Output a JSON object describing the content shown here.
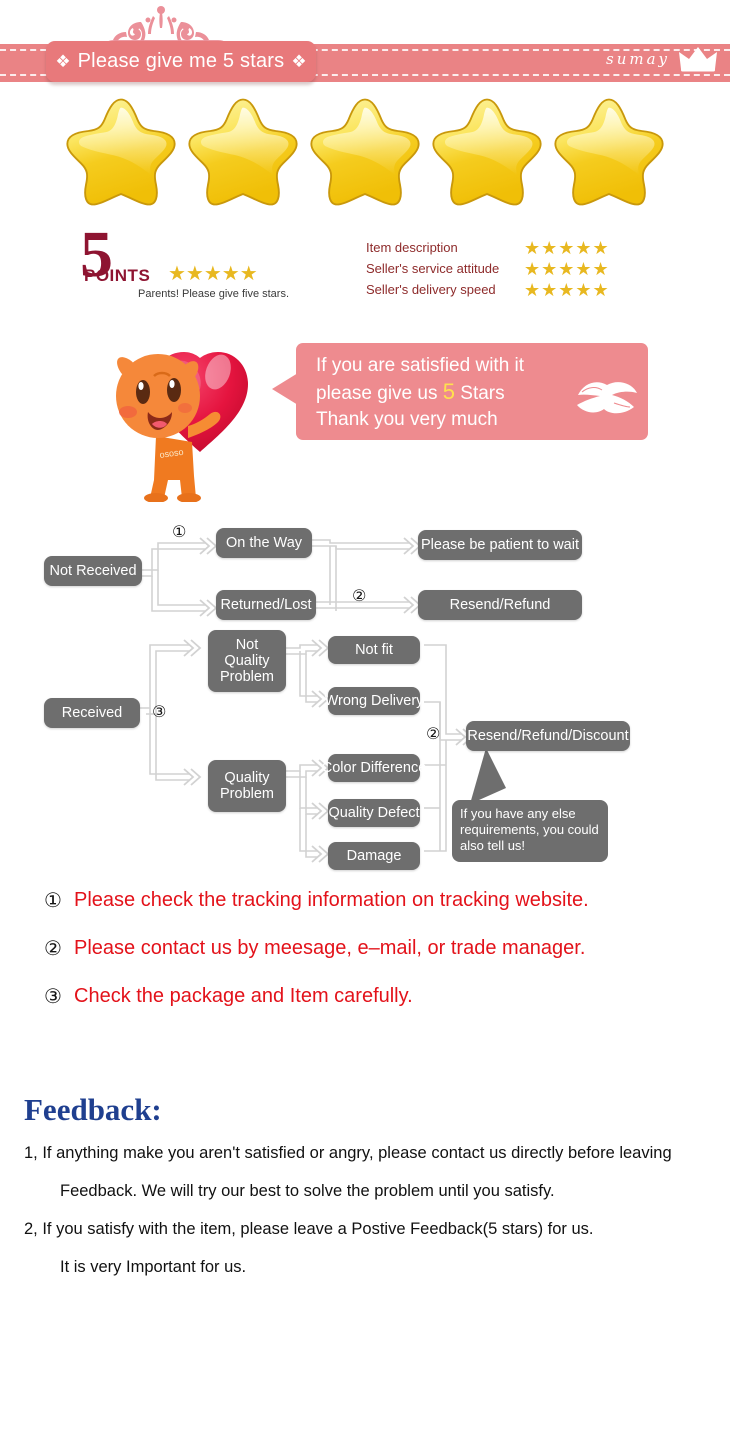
{
  "header": {
    "title": "Please give me 5 stars",
    "brand": "sumay",
    "crown_icon": "crown-icon",
    "left_bowtie_icon": "ribbon-bow-icon",
    "right_bowtie_icon": "ribbon-bow-icon",
    "banner_color": "#ea8385",
    "plaque_color": "#e8797b"
  },
  "big_stars": {
    "count": 5,
    "icon": "gold-star-icon",
    "color": "#f5cc1e"
  },
  "points": {
    "number": "5",
    "word": "POINTS",
    "stars": "★★★★★",
    "caption": "Parents! Please give five stars.",
    "color": "#8e1431"
  },
  "ratings": {
    "rows": [
      {
        "label": "Item description",
        "stars": "★★★★★",
        "value": 5
      },
      {
        "label": "Seller's service attitude",
        "stars": "★★★★★",
        "value": 5
      },
      {
        "label": "Seller's delivery speed",
        "stars": "★★★★★",
        "value": 5
      }
    ],
    "star_color": "#e8b820",
    "label_color": "#8e2b2b"
  },
  "mascot": {
    "icon": "orange-mascot-holding-heart-icon",
    "heart_icon": "red-heart-icon"
  },
  "bubble": {
    "line1": "If you are satisfied with it",
    "line2_a": "please give us",
    "line2_highlight": "5",
    "line2_b": "Stars",
    "line3": "Thank you very much",
    "lips_icon": "lips-kiss-icon",
    "color": "#ee8b8f",
    "highlight_color": "#ffe14d"
  },
  "flow": {
    "box_color": "#6e6e6e",
    "not_received": "Not Received",
    "on_the_way": "On the Way",
    "returned_lost": "Returned/Lost",
    "please_wait": "Please be patient to wait",
    "resend_refund": "Resend/Refund",
    "received": "Received",
    "not_quality_problem": "Not\nQuality\nProblem",
    "not_quality_problem_l1": "Not",
    "not_quality_problem_l2": "Quality",
    "not_quality_problem_l3": "Problem",
    "not_fit": "Not fit",
    "wrong_delivery": "Wrong Delivery",
    "quality_problem_l1": "Quality",
    "quality_problem_l2": "Problem",
    "color_difference": "Color Difference",
    "quality_defect": "Quality Defect",
    "damage": "Damage",
    "resend_refund_discount": "Resend/Refund/Discount",
    "callout": "If you have any else requirements, you could also tell us!",
    "marker_1": "①",
    "marker_2a": "②",
    "marker_2b": "②",
    "marker_3": "③"
  },
  "notes": [
    {
      "num": "①",
      "text": "Please check the tracking information on tracking website."
    },
    {
      "num": "②",
      "text": "Please contact us by meesage, e–mail, or trade manager."
    },
    {
      "num": "③",
      "text": "Check the package and Item carefully."
    }
  ],
  "notes_color": "#e3121a",
  "feedback": {
    "title": "Feedback:",
    "title_color": "#1f3f8f",
    "line1": "1, If anything make you aren't satisfied or angry, please contact us directly before leaving",
    "line1b": "Feedback. We will try our best to solve the problem until you satisfy.",
    "line2": "2, If you satisfy with the item, please leave a Postive Feedback(5 stars) for us.",
    "line2b": "It is very Important for us."
  }
}
